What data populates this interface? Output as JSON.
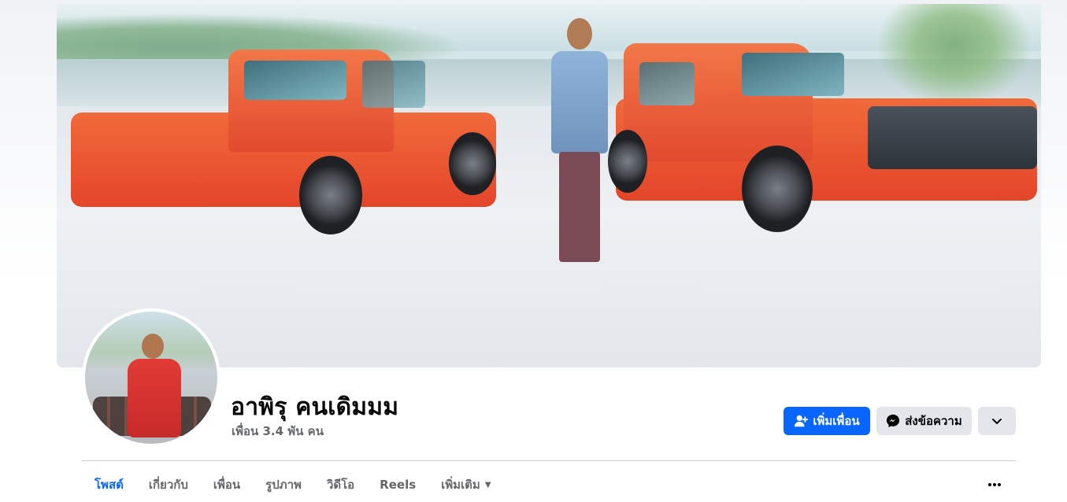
{
  "profile": {
    "name": "อาพิรุ คนเดิมมม",
    "friends_count": "เพื่อน 3.4 พัน คน"
  },
  "actions": {
    "add_friend": "เพิ่มเพื่อน",
    "message": "ส่งข้อความ"
  },
  "tabs": [
    {
      "label": "โพสต์",
      "active": true
    },
    {
      "label": "เกี่ยวกับ",
      "active": false
    },
    {
      "label": "เพื่อน",
      "active": false
    },
    {
      "label": "รูปภาพ",
      "active": false
    },
    {
      "label": "วิดีโอ",
      "active": false
    },
    {
      "label": "Reels",
      "active": false
    },
    {
      "label": "เพิ่มเติม",
      "active": false
    }
  ],
  "colors": {
    "primary": "#0866ff",
    "secondary_button": "#e4e6eb",
    "muted_text": "#65676b"
  },
  "icons": [
    "add-friend-icon",
    "messenger-icon",
    "chevron-down-icon",
    "caret-down-icon",
    "more-dots-icon"
  ]
}
